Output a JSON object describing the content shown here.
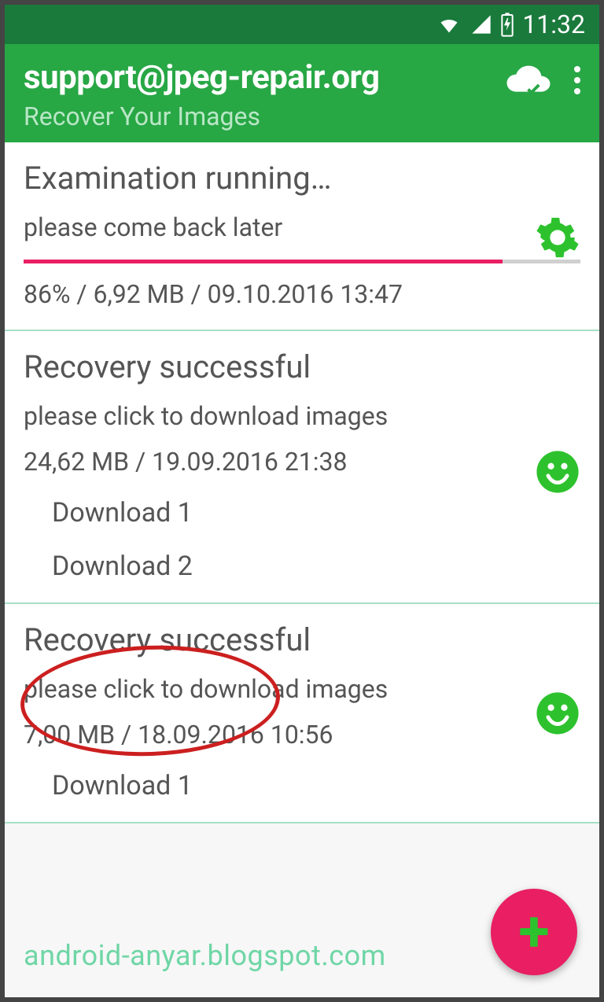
{
  "statusbar": {
    "time": "11:32"
  },
  "appbar": {
    "title": "support@jpeg-repair.org",
    "subtitle": "Recover Your Images"
  },
  "items": [
    {
      "title": "Examination running…",
      "subtitle": "please come back later",
      "meta": "86% / 6,92 MB / 09.10.2016 13:47",
      "progress_percent": 86,
      "icon": "gear"
    },
    {
      "title": "Recovery successful",
      "subtitle": "please click to download images",
      "meta": "24,62 MB / 19.09.2016 21:38",
      "downloads": [
        "Download 1",
        "Download 2"
      ],
      "icon": "smile"
    },
    {
      "title": "Recovery successful",
      "subtitle": "please click to download images",
      "meta": "7,00 MB / 18.09.2016 10:56",
      "downloads": [
        "Download 1"
      ],
      "icon": "smile"
    }
  ],
  "watermark": "android-anyar.blogspot.com",
  "fab": {
    "glyph": "+"
  },
  "colors": {
    "primary": "#28a745",
    "primary_dark": "#1a7a3c",
    "accent_pink": "#e91e63",
    "divider_green": "#a6dfc4",
    "annotation_red": "#cc1f1f"
  }
}
